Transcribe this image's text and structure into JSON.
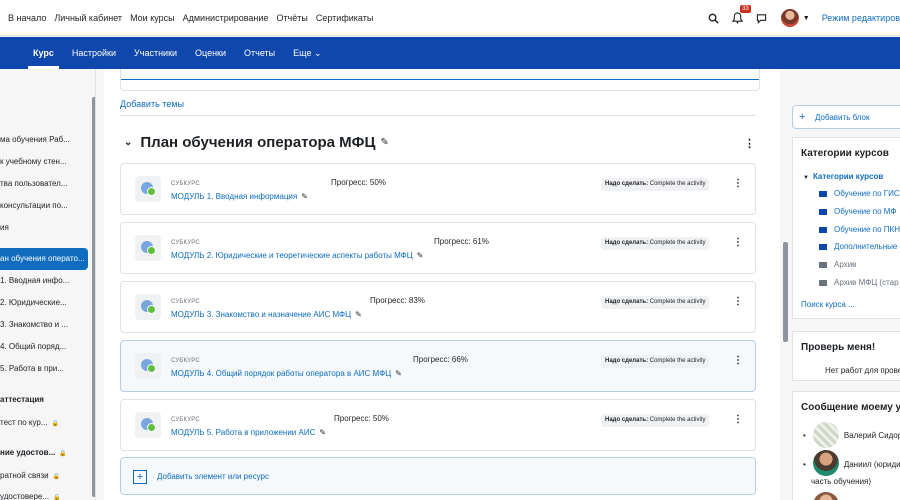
{
  "topnav": {
    "items": [
      "В начало",
      "Личный кабинет",
      "Мои курсы",
      "Администрирование",
      "Отчёты",
      "Сертификаты"
    ],
    "notifications_count": "33",
    "edit_mode_label": "Режим редактиров"
  },
  "coursenav": {
    "tabs": [
      "Курс",
      "Настройки",
      "Участники",
      "Оценки",
      "Отчеты",
      "Еще"
    ],
    "active": "Курс"
  },
  "leftdrawer": {
    "items": [
      "ма обучения Раб...",
      "к учебному стен...",
      "тва пользовател...",
      "консультации по...",
      "ия",
      "ан обучения операто...",
      "1. Вводная инфо...",
      "2. Юридические...",
      "3. Знакомство и ...",
      "4. Общий поряд...",
      "5. Работа в при...",
      "аттестация",
      "тест по кур...",
      "ние удостов...",
      "ратной связи",
      "удостовере..."
    ]
  },
  "main": {
    "add_themes": "Добавить темы",
    "section_title": "План обучения оператора МФЦ",
    "modules": [
      {
        "kind": "СУБКУРС",
        "name": "МОДУЛЬ 1. Вводная информация",
        "progress": "Прогресс: 50%",
        "todo_label": "Надо сделать:",
        "todo_value": "Complete the activity"
      },
      {
        "kind": "СУБКУРС",
        "name": "МОДУЛЬ 2. Юридические и теоретические аспекты работы МФЦ",
        "progress": "Прогресс: 61%",
        "todo_label": "Надо сделать:",
        "todo_value": "Complete the activity"
      },
      {
        "kind": "СУБКУРС",
        "name": "МОДУЛЬ 3. Знакомство и назначение АИС МФЦ",
        "progress": "Прогресс: 83%",
        "todo_label": "Надо сделать:",
        "todo_value": "Complete the activity"
      },
      {
        "kind": "СУБКУРС",
        "name": "МОДУЛЬ 4. Общий порядок работы оператора в АИС МФЦ",
        "progress": "Прогресс: 66%",
        "todo_label": "Надо сделать:",
        "todo_value": "Complete the activity"
      },
      {
        "kind": "СУБКУРС",
        "name": "МОДУЛЬ 5. Работа в приложении АИС",
        "progress": "Прогресс: 50%",
        "todo_label": "Надо сделать:",
        "todo_value": "Complete the activity"
      }
    ],
    "add_resource": "Добавить элемент или ресурс"
  },
  "rightdrawer": {
    "add_block": "Добавить блок",
    "categories": {
      "title": "Категории курсов",
      "root": "Категории курсов",
      "items": [
        "Обучение по ГИС",
        "Обучение по МФ",
        "Обучение по ПКН",
        "Дополнительные",
        "Архив",
        "Архив МФЦ (стар"
      ],
      "search": "Поиск курса ..."
    },
    "check": {
      "title": "Проверь меня!",
      "text": "Нет работ для прове"
    },
    "messages": {
      "title": "Сообщение моему у",
      "items": [
        "Валерий Сидор",
        "Даниил (юриди",
        "часть обучения)"
      ]
    }
  }
}
